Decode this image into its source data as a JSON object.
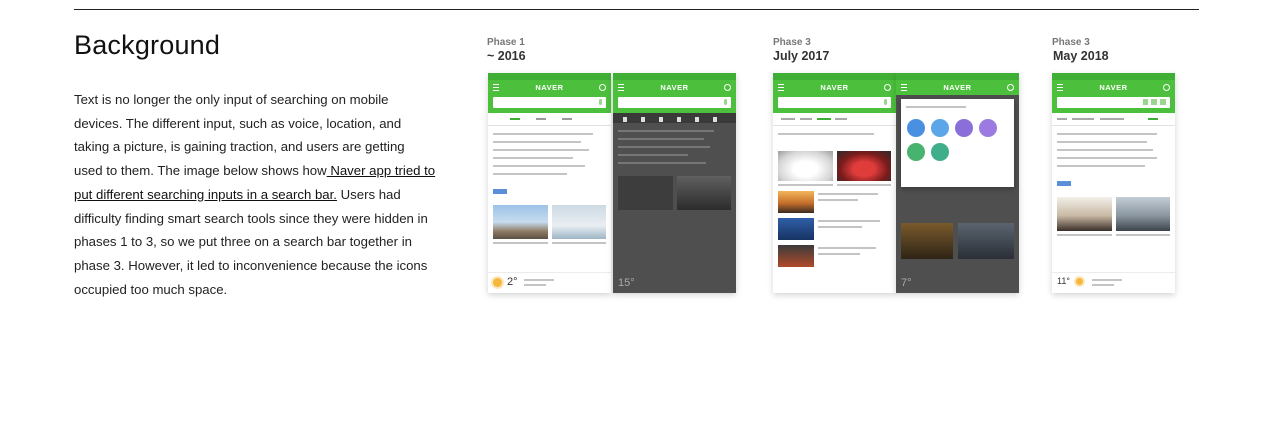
{
  "section": {
    "title": "Background",
    "text_before_link": "Text is no longer the only input of searching on mobile devices. The different input, such as voice, location, and taking a picture, is gaining traction, and users are getting used to them. The image below shows how",
    "link_text": " Naver app tried to put different searching inputs in a search bar.",
    "text_after_link": " Users had difficulty finding smart search tools since they were hidden in phases 1 to 3, so we put three on a search bar together in phase 3. However, it led to inconvenience because the icons occupied too much space."
  },
  "phases": [
    {
      "label": "Phase 1",
      "date": "~ 2016"
    },
    {
      "label": "Phase 3",
      "date": "July 2017"
    },
    {
      "label": "Phase 3",
      "date": "May 2018"
    }
  ],
  "phones": {
    "logo": "NAVER",
    "p1_temp": "2°",
    "p2_temp": "15°",
    "p3_temp": "7°",
    "p4_temp": "11°"
  },
  "colors": {
    "naver_green": "#4cbf3c",
    "text": "#222222",
    "rule": "#222222"
  }
}
